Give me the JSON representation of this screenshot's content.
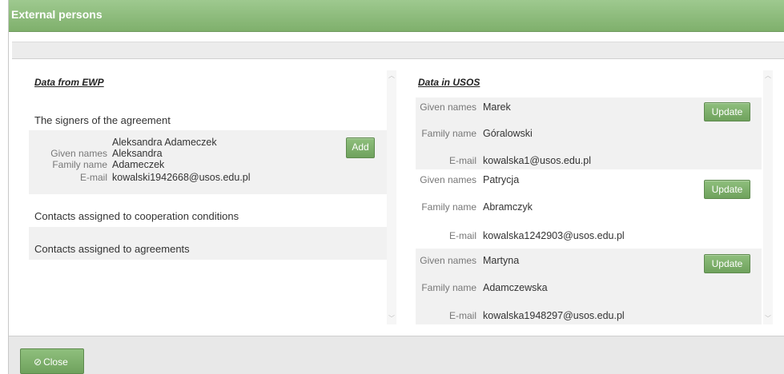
{
  "window": {
    "title": "External persons"
  },
  "left": {
    "title": "Data from EWP",
    "signers_heading": "The signers of the agreement",
    "signer": {
      "full_name": "Aleksandra Adameczek",
      "given_label": "Given names",
      "given": "Aleksandra",
      "family_label": "Family name",
      "family": "Adameczek",
      "email_label": "E-mail",
      "email": "kowalski1942668@usos.edu.pl",
      "add_label": "Add"
    },
    "cooperation_heading": "Contacts assigned to cooperation conditions",
    "agreements_heading": "Contacts assigned to agreements"
  },
  "right": {
    "title": "Data in USOS",
    "given_label": "Given names",
    "family_label": "Family name",
    "email_label": "E-mail",
    "update_label": "Update",
    "persons": [
      {
        "given": "Marek",
        "family": "Góralowski",
        "email": "kowalska1@usos.edu.pl"
      },
      {
        "given": "Patrycja",
        "family": "Abramczyk",
        "email": "kowalska1242903@usos.edu.pl"
      },
      {
        "given": "Martyna",
        "family": "Adamczewska",
        "email": "kowalska1948297@usos.edu.pl"
      }
    ]
  },
  "footer": {
    "close_label": "Close",
    "close_icon": "⊘"
  }
}
